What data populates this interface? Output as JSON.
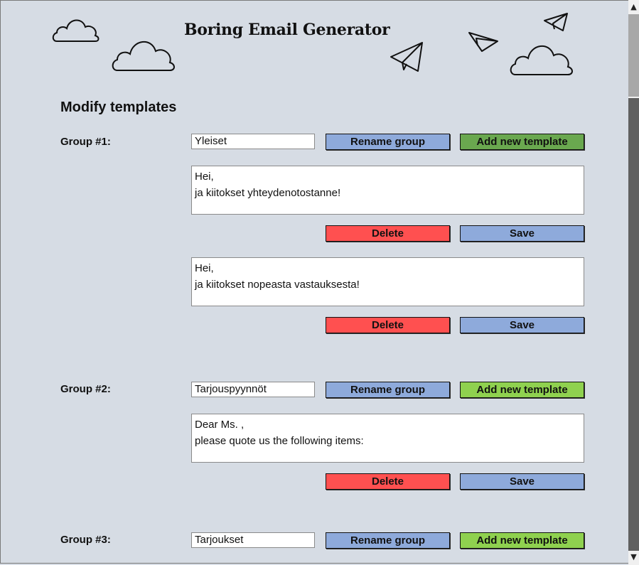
{
  "app": {
    "title": "Boring Email Generator"
  },
  "section": {
    "title": "Modify templates"
  },
  "labels": {
    "rename": "Rename group",
    "add": "Add new template",
    "delete": "Delete",
    "save": "Save"
  },
  "groups": [
    {
      "label": "Group #1:",
      "name": "Yleiset",
      "templates": [
        "Hei,\nja kiitokset yhteydenotostanne!",
        "Hei,\nja kiitokset nopeasta vastauksesta!"
      ]
    },
    {
      "label": "Group #2:",
      "name": "Tarjouspyynnöt",
      "templates": [
        "Dear Ms. ,\nplease quote us the following items:"
      ]
    },
    {
      "label": "Group #3:",
      "name": "Tarjoukset",
      "templates": []
    }
  ],
  "colors": {
    "background": "#d6dce4",
    "rename_button": "#8eaadb",
    "add_button_active": "#6aa84f",
    "add_button": "#8fd14f",
    "delete_button": "#ff5050",
    "save_button": "#8eaadb"
  },
  "icons": {
    "clouds": "cloud-icon",
    "planes": "paper-plane-icon"
  }
}
